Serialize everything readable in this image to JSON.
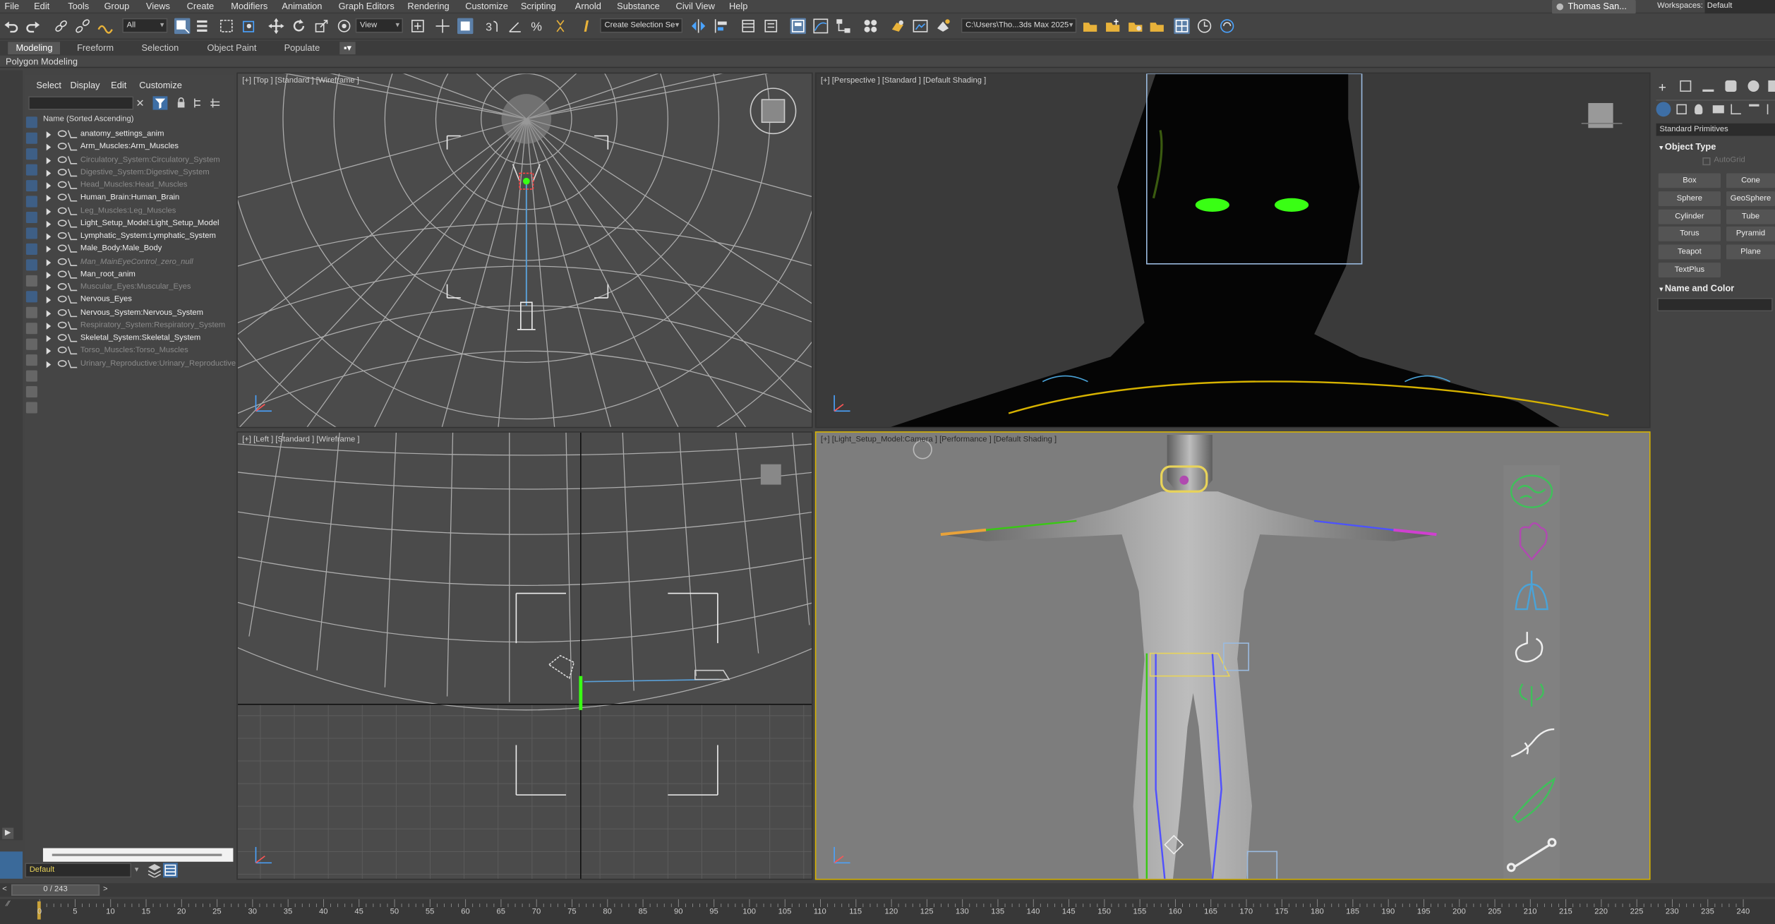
{
  "menubar": {
    "items": [
      "File",
      "Edit",
      "Tools",
      "Group",
      "Views",
      "Create",
      "Modifiers",
      "Animation",
      "Graph Editors",
      "Rendering",
      "Customize",
      "Scripting",
      "Arnold",
      "Substance",
      "Civil View",
      "Help"
    ],
    "user": "Thomas San...",
    "workspaces_label": "Workspaces:",
    "workspace_value": "Default"
  },
  "toolbar": {
    "filter_value": "All",
    "refcoord_value": "View",
    "selection_set_value": "Create Selection Se",
    "project_path": "C:\\Users\\Tho...3ds Max 2025"
  },
  "ribbon": {
    "tabs": [
      "Modeling",
      "Freeform",
      "Selection",
      "Object Paint",
      "Populate"
    ],
    "active_tab": "Modeling",
    "subtitle": "Polygon Modeling"
  },
  "scene_explorer": {
    "menus": [
      "Select",
      "Display",
      "Edit",
      "Customize"
    ],
    "column_header": "Name (Sorted Ascending)",
    "rows": [
      {
        "name": "anatomy_settings_anim",
        "style": "normal"
      },
      {
        "name": "Arm_Muscles:Arm_Muscles",
        "style": "normal"
      },
      {
        "name": "Circulatory_System:Circulatory_System",
        "style": "dim"
      },
      {
        "name": "Digestive_System:Digestive_System",
        "style": "dim"
      },
      {
        "name": "Head_Muscles:Head_Muscles",
        "style": "dim"
      },
      {
        "name": "Human_Brain:Human_Brain",
        "style": "normal"
      },
      {
        "name": "Leg_Muscles:Leg_Muscles",
        "style": "dim"
      },
      {
        "name": "Light_Setup_Model:Light_Setup_Model",
        "style": "normal"
      },
      {
        "name": "Lymphatic_System:Lymphatic_System",
        "style": "normal"
      },
      {
        "name": "Male_Body:Male_Body",
        "style": "normal"
      },
      {
        "name": "Man_MainEyeControl_zero_null",
        "style": "italic"
      },
      {
        "name": "Man_root_anim",
        "style": "normal"
      },
      {
        "name": "Muscular_Eyes:Muscular_Eyes",
        "style": "dim"
      },
      {
        "name": "Nervous_Eyes",
        "style": "normal"
      },
      {
        "name": "Nervous_System:Nervous_System",
        "style": "normal"
      },
      {
        "name": "Respiratory_System:Respiratory_System",
        "style": "dim"
      },
      {
        "name": "Skeletal_System:Skeletal_System",
        "style": "normal"
      },
      {
        "name": "Torso_Muscles:Torso_Muscles",
        "style": "dim"
      },
      {
        "name": "Urinary_Reproductive:Urinary_Reproductive",
        "style": "dim"
      }
    ],
    "layer_value": "Default"
  },
  "viewports": {
    "top_left": "[+] [Top ] [Standard ] [Wireframe ]",
    "top_right": "[+] [Perspective ] [Standard ] [Default Shading ]",
    "bottom_left": "[+] [Left ] [Standard ] [Wireframe ]",
    "bottom_right": "[+] [Light_Setup_Model:Camera ] [Performance ] [Default Shading ]"
  },
  "command_panel": {
    "category": "Standard Primitives",
    "object_type_title": "Object Type",
    "autogrid": "AutoGrid",
    "buttons": [
      "Box",
      "Cone",
      "Sphere",
      "GeoSphere",
      "Cylinder",
      "Tube",
      "Torus",
      "Pyramid",
      "Teapot",
      "Plane",
      "TextPlus"
    ],
    "name_color_title": "Name and Color"
  },
  "timeline": {
    "frame_display": "0 / 243",
    "ticks": [
      "0",
      "5",
      "10",
      "15",
      "20",
      "25",
      "30",
      "35",
      "40",
      "45",
      "50",
      "55",
      "60",
      "65",
      "70",
      "75",
      "80",
      "85",
      "90",
      "95",
      "100",
      "105",
      "110",
      "115",
      "120",
      "125",
      "130",
      "135",
      "140",
      "145",
      "150",
      "155",
      "160",
      "165",
      "170",
      "175",
      "180",
      "185",
      "190",
      "195",
      "200",
      "205",
      "210",
      "215",
      "220",
      "225",
      "230",
      "235",
      "240"
    ]
  },
  "colors": {
    "selection_blue": "#5b7fa8",
    "viewport_active_border": "#d6b200",
    "wireframe_grey": "#bdbdbd",
    "eye_glow": "#39ff14"
  },
  "organ_icons": [
    "brain-icon",
    "heart-icon",
    "lungs-icon",
    "stomach-icon",
    "kidneys-icon",
    "nerve-icon",
    "muscle-icon",
    "bone-icon"
  ]
}
